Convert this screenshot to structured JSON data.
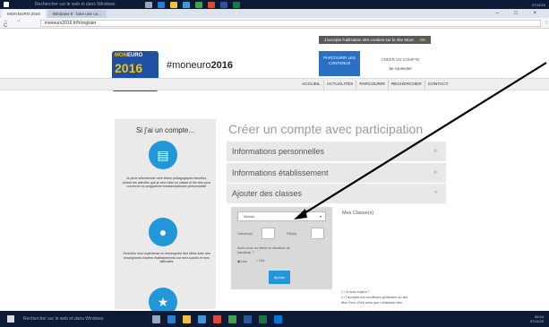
{
  "taskbar_top": {
    "search_placeholder": "Rechercher sur le web et dans Windows",
    "tray": "07/11/20"
  },
  "browser": {
    "tabs": [
      {
        "label": "MON EURO 2016",
        "active": true
      },
      {
        "label": "Windows 8 : faire une ca...",
        "active": false
      }
    ],
    "window_controls": "– □ ×",
    "url": "moneuro2016.fr/fr/register",
    "nav_glyphs": "← → C"
  },
  "site": {
    "cookie_notice": "J'accepte l'utilisation des cookies sur le site Moec",
    "cookie_ok": "OK",
    "logo_mon": "MON",
    "logo_euro": "EURO",
    "logo_year": "2016",
    "logo_figures": "★.★★",
    "brand_hash": "#moneuro",
    "brand_year": "2016",
    "parcourir": "PARCOURIR LES CONTENUS",
    "creer_compte": "CRÉER UN COMPTE",
    "se_connecter": "Se connecter",
    "nav": [
      "ACCUEIL",
      "ACTUALITÉS",
      "PARCOURIR",
      "RECHERCHER",
      "CONTACT"
    ]
  },
  "left_panel": {
    "title": "Si j'ai un compte...",
    "items": [
      {
        "icon": "folder-icon",
        "glyph": "▤",
        "text": "Je peux sélectionner mes fiches pédagogiques favorites, choisir les activités que je veux faire en classe et les trier pour concevoir un programme transdisciplinaire personnalisé"
      },
      {
        "icon": "chat-icon",
        "glyph": "●",
        "text": "J'enrichis mon expérience en échangeant des idées avec des enseignants d'autres établissements sur mes succès et mes difficultés"
      },
      {
        "icon": "runner-icon",
        "glyph": "★",
        "text": ""
      }
    ]
  },
  "main": {
    "heading": "Créer un compte avec participation",
    "sections": [
      {
        "label": "Informations personnelles",
        "arrow": "▶"
      },
      {
        "label": "Informations établissement",
        "arrow": "▶"
      },
      {
        "label": "Ajouter des classes",
        "arrow": "▼"
      }
    ],
    "form": {
      "select_value": "Niveau",
      "caret": "▾",
      "garcons_label": "Garçon(s)",
      "filles_label": "Fille(s)",
      "handicap_question": "Avez-vous un élève en situation de handicap ?",
      "non_label": "Non",
      "oui_label": "Oui",
      "ajouter_label": "Ajouter"
    },
    "mes_classes": "Mes Classe(s)",
    "legal": [
      "☐ Je suis majeur *",
      "☐ J'accepte les conditions générales du site",
      "Mon Euro 2016 ainsi que l'utilisation des"
    ]
  },
  "taskbar_bottom": {
    "search_placeholder": "Rechercher sur le web et dans Windows",
    "time": "09:24",
    "date": "07/11/20"
  },
  "colors": {
    "accent_blue": "#2196d8",
    "taskbar": "#0c1a36",
    "logo_blue": "#1e4fa3",
    "logo_yellow": "#f5c400"
  }
}
